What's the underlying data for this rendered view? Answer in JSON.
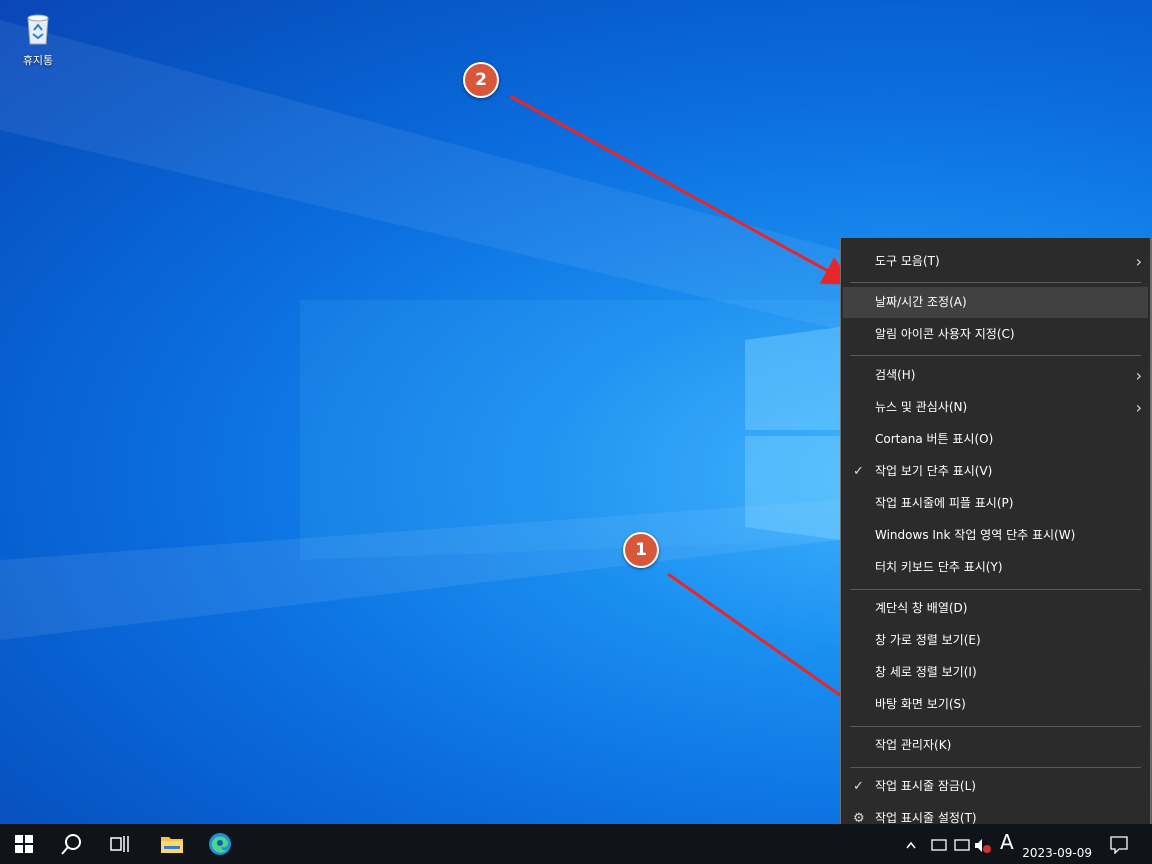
{
  "desktop": {
    "recycle_bin_label": "휴지통"
  },
  "callouts": {
    "first": "1",
    "second": "2"
  },
  "context_menu": {
    "toolbars": "도구 모음(T)",
    "adjust_datetime": "날짜/시간 조정(A)",
    "customize_notification_icons": "알림 아이콘 사용자 지정(C)",
    "search": "검색(H)",
    "news_interests": "뉴스 및 관심사(N)",
    "show_cortana": "Cortana 버튼 표시(O)",
    "show_task_view": "작업 보기 단추 표시(V)",
    "show_people": "작업 표시줄에 피플 표시(P)",
    "show_ink_workspace": "Windows Ink 작업 영역 단추 표시(W)",
    "show_touch_keyboard": "터치 키보드 단추 표시(Y)",
    "cascade_windows": "계단식 창 배열(D)",
    "show_stacked": "창 가로 정렬 보기(E)",
    "show_side_by_side": "창 세로 정렬 보기(I)",
    "show_desktop": "바탕 화면 보기(S)",
    "task_manager": "작업 관리자(K)",
    "lock_taskbar": "작업 표시줄 잠금(L)",
    "taskbar_settings": "작업 표시줄 설정(T)"
  },
  "taskbar": {
    "clock_date": "2023-09-09"
  },
  "colors": {
    "callout": "#d8573a",
    "arrow": "#e8262a",
    "menu_bg": "#2b2b2b",
    "menu_highlight": "#414141"
  }
}
